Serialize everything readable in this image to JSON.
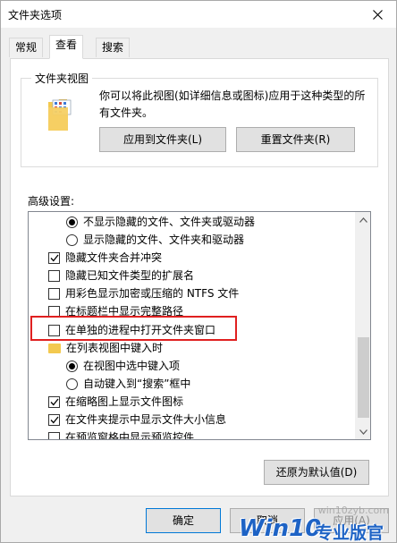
{
  "window": {
    "title": "文件夹选项"
  },
  "tabs": [
    {
      "label": "常规"
    },
    {
      "label": "查看"
    },
    {
      "label": "搜索"
    }
  ],
  "folder_views": {
    "group_label": "文件夹视图",
    "description": "你可以将此视图(如详细信息或图标)应用于这种类型的所有文件夹。",
    "apply_label": "应用到文件夹(L)",
    "reset_label": "重置文件夹(R)"
  },
  "advanced": {
    "label": "高级设置:",
    "items": [
      {
        "kind": "radio",
        "checked": true,
        "text": "不显示隐藏的文件、文件夹或驱动器"
      },
      {
        "kind": "radio",
        "checked": false,
        "text": "显示隐藏的文件、文件夹和驱动器"
      },
      {
        "kind": "checkbox",
        "checked": true,
        "text": "隐藏文件夹合并冲突"
      },
      {
        "kind": "checkbox",
        "checked": false,
        "text": "隐藏已知文件类型的扩展名"
      },
      {
        "kind": "checkbox",
        "checked": false,
        "text": "用彩色显示加密或压缩的 NTFS 文件"
      },
      {
        "kind": "checkbox",
        "checked": false,
        "text": "在标题栏中显示完整路径"
      },
      {
        "kind": "checkbox",
        "checked": false,
        "text": "在单独的进程中打开文件夹窗口"
      },
      {
        "kind": "folder",
        "checked": false,
        "text": "在列表视图中键入时"
      },
      {
        "kind": "radio",
        "checked": true,
        "text": "在视图中选中键入项"
      },
      {
        "kind": "radio",
        "checked": false,
        "text": "自动键入到“搜索”框中"
      },
      {
        "kind": "checkbox",
        "checked": true,
        "text": "在缩略图上显示文件图标"
      },
      {
        "kind": "checkbox",
        "checked": true,
        "text": "在文件夹提示中显示文件大小信息"
      },
      {
        "kind": "checkbox",
        "checked": false,
        "text": "在预览窗格中显示预览控件"
      }
    ],
    "restore_label": "还原为默认值(D)"
  },
  "footer": {
    "ok_label": "确定",
    "cancel_label": "取消",
    "apply_label": "应用(A)"
  },
  "watermark": {
    "url": "win10zyb.com",
    "brand": "Win10",
    "tagline": "专业版官网",
    "color": "#1e63c5"
  },
  "highlight_color": "#e02020"
}
